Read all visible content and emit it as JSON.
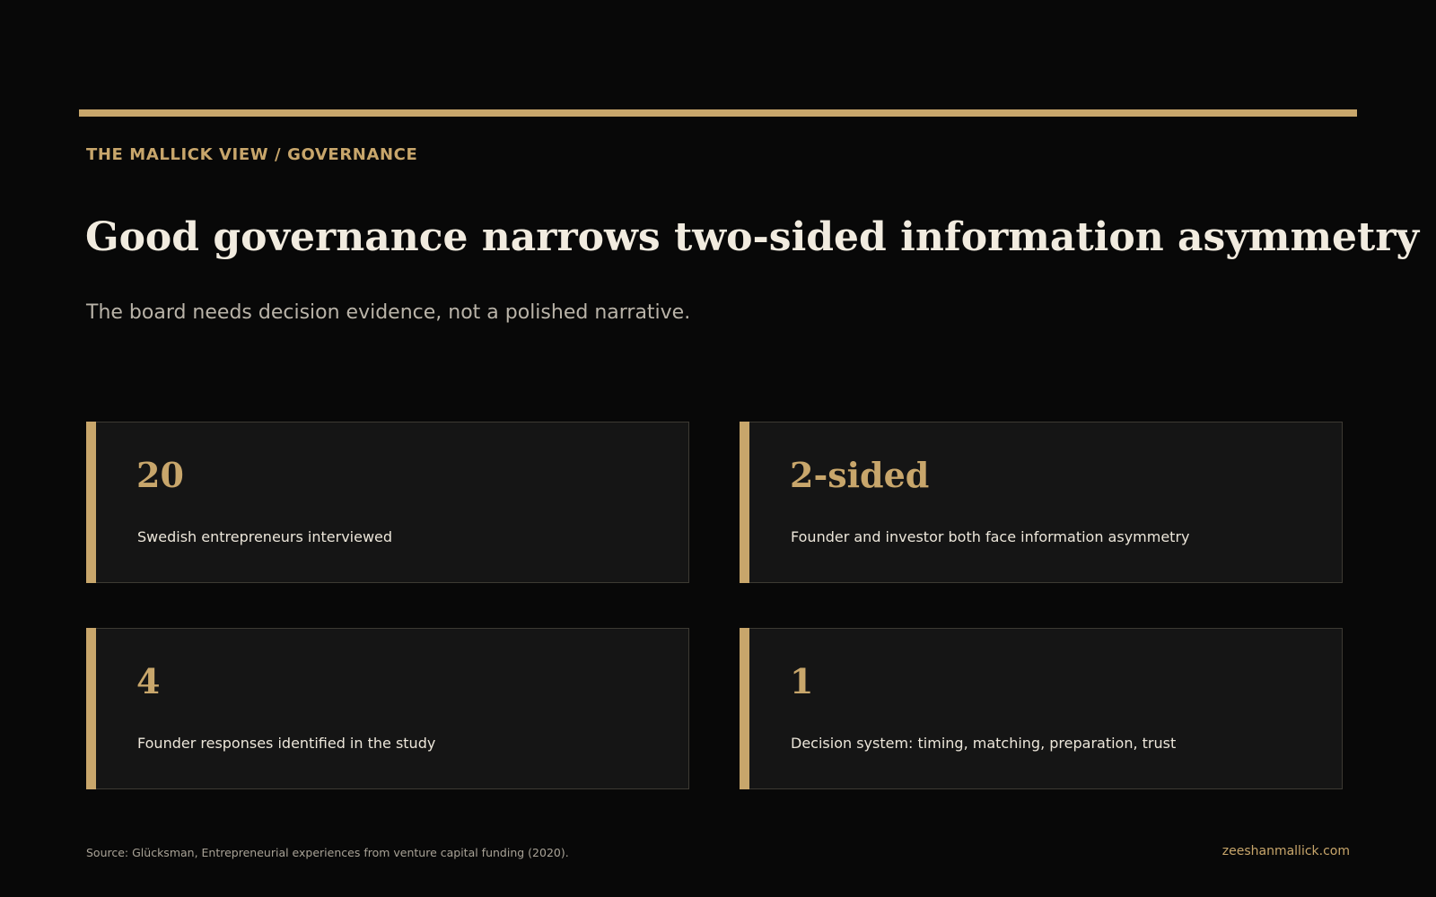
{
  "header": {
    "eyebrow": "THE MALLICK VIEW / GOVERNANCE",
    "title": "Good governance narrows two-sided information asymmetry",
    "subtitle": "The board needs decision evidence, not a polished narrative."
  },
  "stats": [
    {
      "value": "20",
      "label": "Swedish entrepreneurs interviewed"
    },
    {
      "value": "2-sided",
      "label": "Founder and investor both face information asymmetry"
    },
    {
      "value": "4",
      "label": "Founder responses identified in the study"
    },
    {
      "value": "1",
      "label": "Decision system: timing, matching, preparation, trust"
    }
  ],
  "footer": {
    "source": "Source: Glücksman, Entrepreneurial experiences from venture capital funding (2020).",
    "site": "zeeshanmallick.com"
  },
  "colors": {
    "background": "#080808",
    "accent": "#c8a66b",
    "card": "#151515",
    "text": "#f1ebdf"
  }
}
